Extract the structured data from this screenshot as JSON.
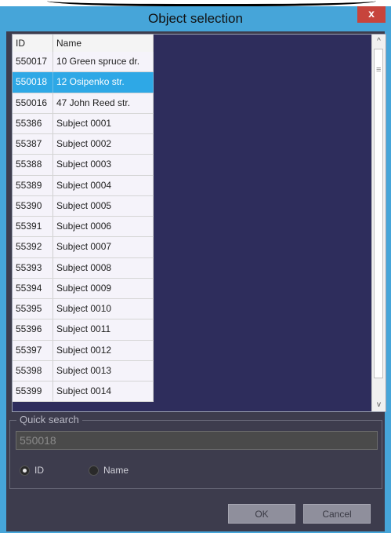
{
  "window": {
    "title": "Object selection",
    "close_glyph": "x"
  },
  "grid": {
    "columns": [
      "ID",
      "Name"
    ],
    "selected_id": "550018",
    "rows": [
      {
        "id": "550017",
        "name": "10 Green spruce dr."
      },
      {
        "id": "550018",
        "name": "12 Osipenko str."
      },
      {
        "id": "550016",
        "name": "47 John Reed str."
      },
      {
        "id": "55386",
        "name": "Subject 0001"
      },
      {
        "id": "55387",
        "name": "Subject 0002"
      },
      {
        "id": "55388",
        "name": "Subject 0003"
      },
      {
        "id": "55389",
        "name": "Subject 0004"
      },
      {
        "id": "55390",
        "name": "Subject 0005"
      },
      {
        "id": "55391",
        "name": "Subject 0006"
      },
      {
        "id": "55392",
        "name": "Subject 0007"
      },
      {
        "id": "55393",
        "name": "Subject 0008"
      },
      {
        "id": "55394",
        "name": "Subject 0009"
      },
      {
        "id": "55395",
        "name": "Subject 0010"
      },
      {
        "id": "55396",
        "name": "Subject 0011"
      },
      {
        "id": "55397",
        "name": "Subject 0012"
      },
      {
        "id": "55398",
        "name": "Subject 0013"
      },
      {
        "id": "55399",
        "name": "Subject 0014"
      }
    ]
  },
  "scrollbar": {
    "up_glyph": "^",
    "down_glyph": "v",
    "grip_glyph": "≡"
  },
  "quick_search": {
    "label": "Quick search",
    "value": "550018",
    "options": [
      {
        "label": "ID",
        "checked": true
      },
      {
        "label": "Name",
        "checked": false
      }
    ]
  },
  "buttons": {
    "ok": "OK",
    "cancel": "Cancel"
  },
  "colors": {
    "titlebar": "#46a5d9",
    "close_button": "#c7443c",
    "client_background": "#3d3c4d",
    "grid_background": "#2e2d5c",
    "row_background": "#f5f3fa",
    "selected_row": "#2ea8e6"
  }
}
